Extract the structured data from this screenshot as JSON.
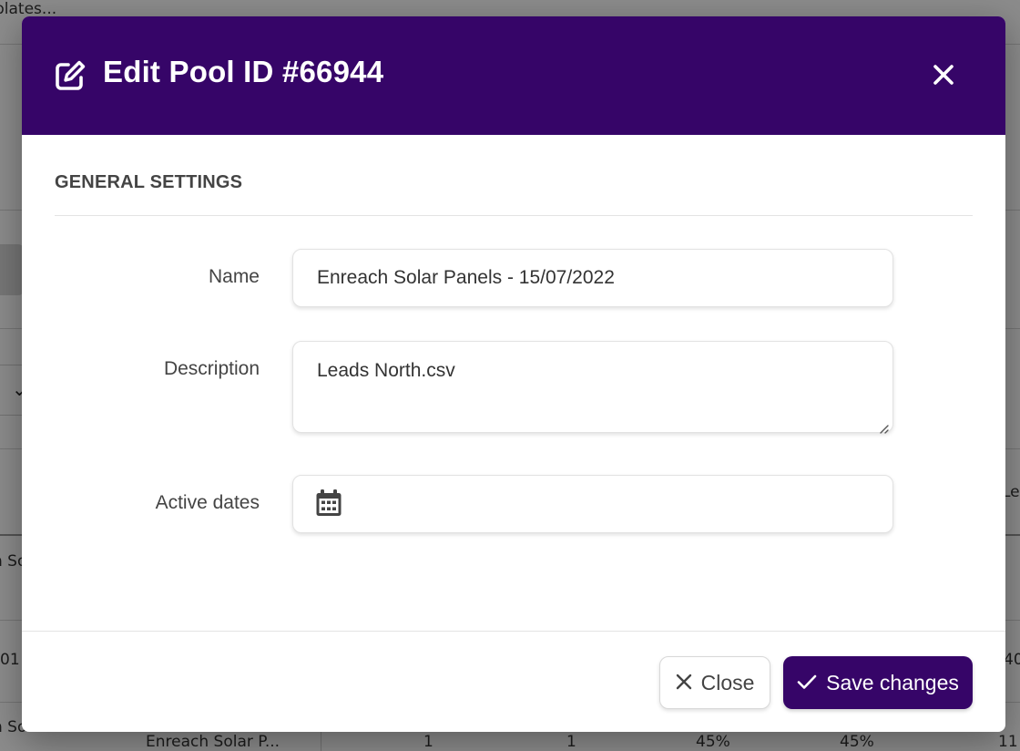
{
  "background": {
    "top_fragment": "plates...",
    "left_row1": "n Sola",
    "left_row2": "01",
    "left_row3": "n Sola",
    "right_header": "Le",
    "right_row2": "40",
    "right_row3": "11",
    "bottom_cells": [
      "Enreach Solar P...",
      "1",
      "1",
      "45%",
      "45%"
    ]
  },
  "modal": {
    "title": "Edit Pool ID #66944",
    "section_title": "GENERAL SETTINGS",
    "fields": {
      "name": {
        "label": "Name",
        "value": "Enreach Solar Panels - 15/07/2022"
      },
      "description": {
        "label": "Description",
        "value": "Leads North.csv"
      },
      "active_dates": {
        "label": "Active dates",
        "value": ""
      }
    },
    "buttons": {
      "close_label": "Close",
      "save_label": "Save changes"
    }
  },
  "colors": {
    "brand": "#360568",
    "text": "#444444",
    "border": "#e2e2e2"
  },
  "icons": {
    "header": "edit-icon",
    "dismiss": "close-icon",
    "date": "calendar-icon",
    "close_button": "close-icon",
    "save_button": "check-icon"
  }
}
